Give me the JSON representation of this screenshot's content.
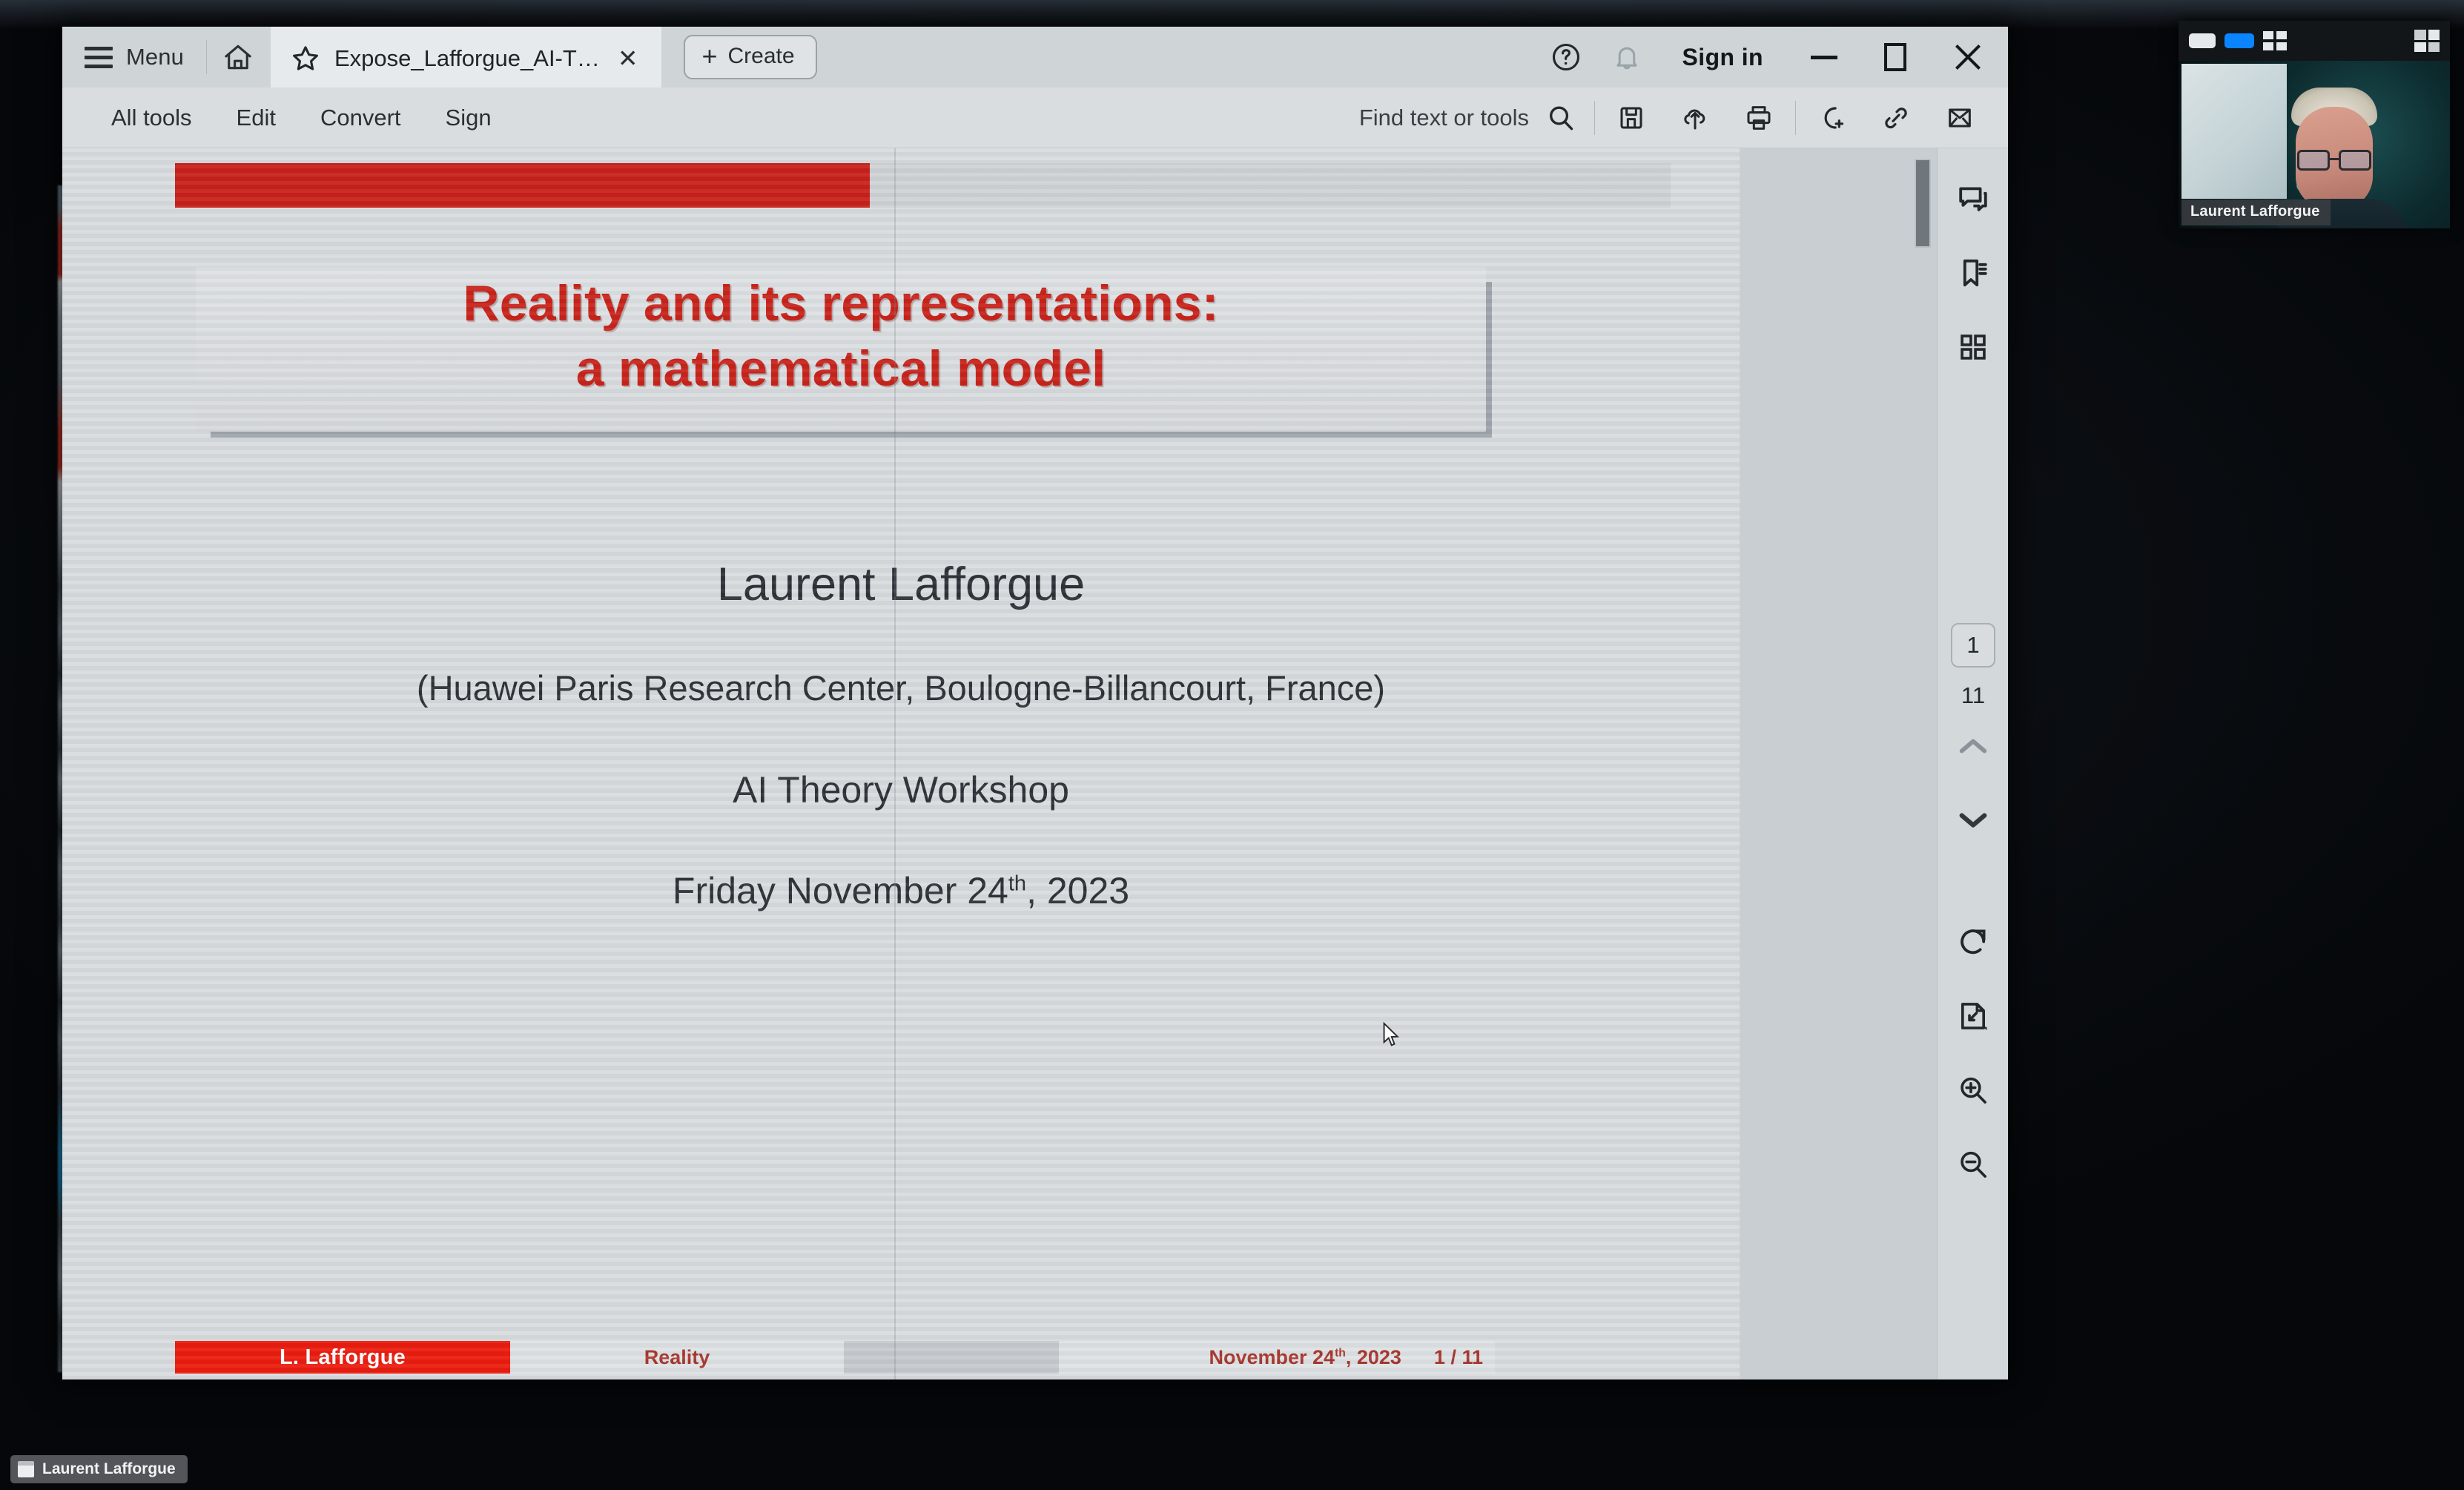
{
  "app": {
    "name": "Adobe Acrobat",
    "tabbar": {
      "menu_label": "Menu",
      "home_icon": "home-icon",
      "tab": {
        "star_icon": "star-icon",
        "title": "Expose_Lafforgue_AI-T…",
        "close_icon": "close-icon"
      },
      "create_button": {
        "plus": "+",
        "label": "Create"
      },
      "help_icon": "help-circle-icon",
      "bell_icon": "bell-icon",
      "sign_in_label": "Sign in",
      "window_controls": {
        "minimize": "minimize-icon",
        "maximize": "maximize-icon",
        "close": "close-icon"
      }
    },
    "toolbar": {
      "menus": [
        "All tools",
        "Edit",
        "Convert",
        "Sign"
      ],
      "find": {
        "placeholder": "Find text or tools",
        "icon": "search-icon"
      },
      "icons": [
        "save-icon",
        "upload-cloud-icon",
        "print-icon",
        "add-user-icon",
        "share-link-icon",
        "email-icon"
      ]
    },
    "right_rail": {
      "top_icons": [
        "comment-icon",
        "bookmark-icon",
        "thumbnails-grid-icon"
      ],
      "page_current": "1",
      "page_total": "11",
      "prev_page_icon": "chevron-up-icon",
      "next_page_icon": "chevron-down-icon",
      "bottom_icons": [
        "rotate-clockwise-icon",
        "fit-page-icon",
        "zoom-in-icon",
        "zoom-out-icon"
      ]
    },
    "scrollbar": {
      "orientation": "vertical",
      "thumb_position": "top"
    }
  },
  "document": {
    "slide": {
      "title_line1": "Reality and its representations:",
      "title_line2": "a mathematical model",
      "author": "Laurent Lafforgue",
      "affiliation": "(Huawei Paris Research Center, Boulogne-Billancourt, France)",
      "event": "AI Theory Workshop",
      "date_prefix": "Friday November 24",
      "date_sup": "th",
      "date_suffix": ", 2023",
      "footer": {
        "author_short": "L. Lafforgue",
        "short_title": "Reality",
        "date_prefix": "November 24",
        "date_sup": "th",
        "date_suffix": ", 2023",
        "page_indicator": "1 / 11"
      }
    }
  },
  "video_call": {
    "participant_name": "Laurent Lafforgue",
    "toolbar_icons": [
      "mic-chip",
      "camera-chip-active",
      "grid-view-icon",
      "expand-icon"
    ]
  },
  "taskbar": {
    "items": [
      {
        "icon": "window-icon",
        "label": "Laurent Lafforgue"
      }
    ]
  },
  "colors": {
    "beamer_red": "#c8221c",
    "footer_red": "#ea1d0f",
    "title_red": "#c8241c",
    "footer_text_red": "#a8392f",
    "slide_bg": "#d9dcdf",
    "chrome_bg": "#d5d9dc",
    "accent_blue": "#0a84ff"
  }
}
